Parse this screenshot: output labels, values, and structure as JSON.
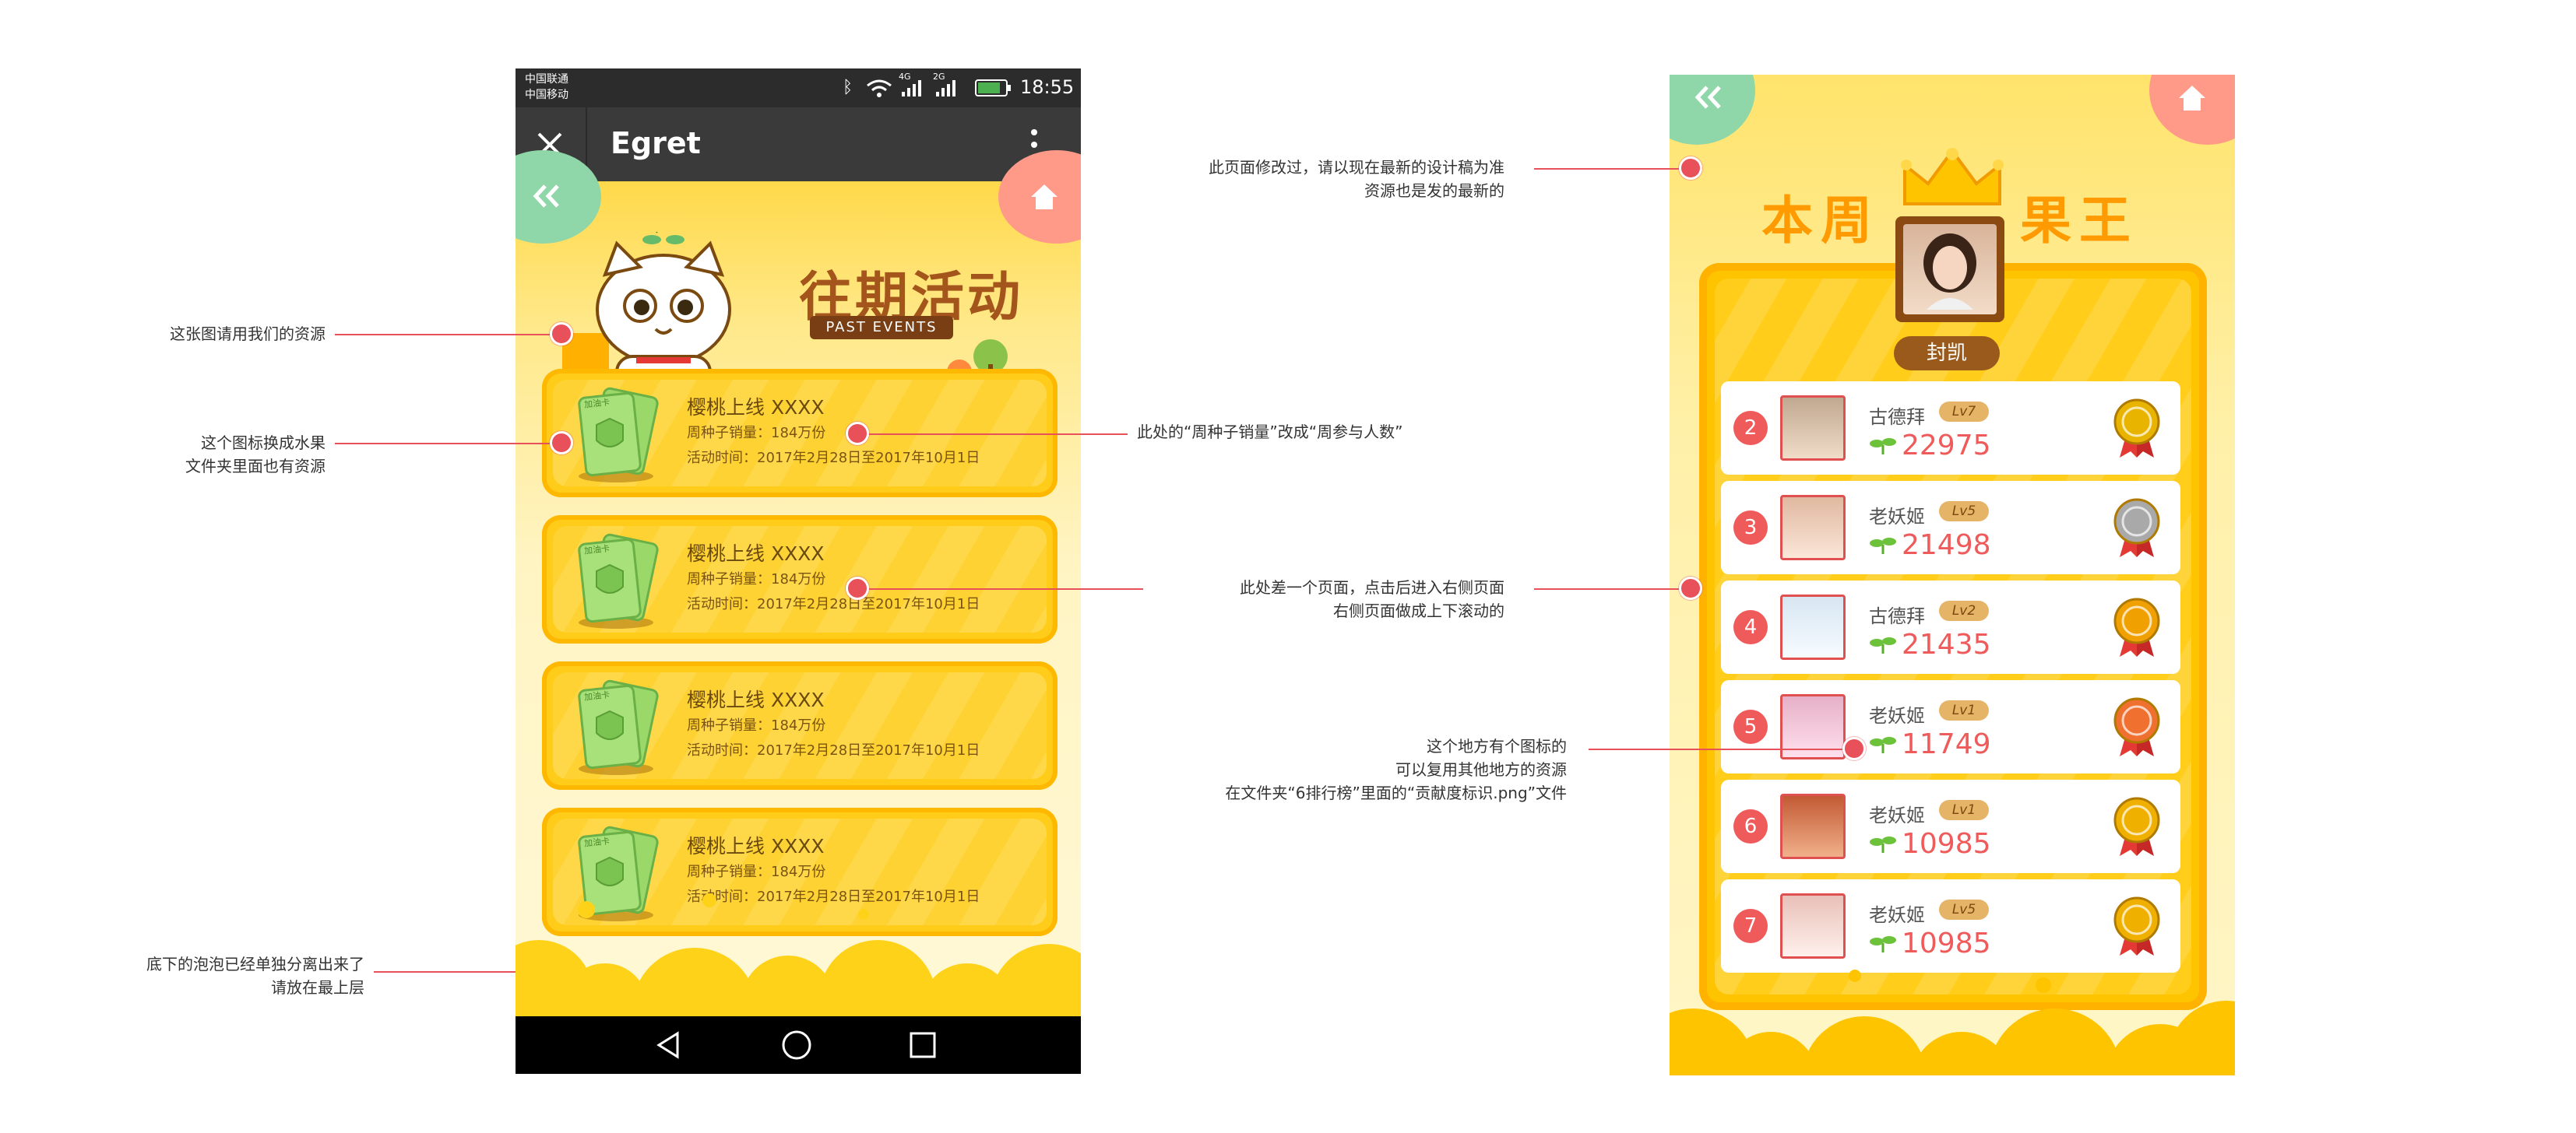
{
  "phone1": {
    "status": {
      "carrier1": "中国联通",
      "carrier2": "中国移动",
      "net1": "4G",
      "net2": "2G",
      "time": "18:55"
    },
    "title": "Egret",
    "banner_title": "往期活动",
    "banner_sub": "PAST EVENTS",
    "cards": [
      {
        "title": "樱桃上线 XXXX",
        "sales": "周种子销量：184万份",
        "time": "活动时间：2017年2月28日至2017年10月1日"
      },
      {
        "title": "樱桃上线 XXXX",
        "sales": "周种子销量：184万份",
        "time": "活动时间：2017年2月28日至2017年10月1日"
      },
      {
        "title": "樱桃上线 XXXX",
        "sales": "周种子销量：184万份",
        "time": "活动时间：2017年2月28日至2017年10月1日"
      },
      {
        "title": "樱桃上线 XXXX",
        "sales": "周种子销量：184万份",
        "time": "活动时间：2017年2月28日至2017年10月1日"
      }
    ],
    "card_label": "加油卡"
  },
  "phone2": {
    "title_left": "本周",
    "title_right": "果王",
    "king": "封凯",
    "rows": [
      {
        "rank": "2",
        "name": "古德拜",
        "lv": "Lv7",
        "score": "22975",
        "medal": "#e8b400"
      },
      {
        "rank": "3",
        "name": "老妖姬",
        "lv": "Lv5",
        "score": "21498",
        "medal": "#a9a9a9"
      },
      {
        "rank": "4",
        "name": "古德拜",
        "lv": "Lv2",
        "score": "21435",
        "medal": "#f0a000"
      },
      {
        "rank": "5",
        "name": "老妖姬",
        "lv": "Lv1",
        "score": "11749",
        "medal": "#f07030"
      },
      {
        "rank": "6",
        "name": "老妖姬",
        "lv": "Lv1",
        "score": "10985",
        "medal": "#f0b000"
      },
      {
        "rank": "7",
        "name": "老妖姬",
        "lv": "Lv5",
        "score": "10985",
        "medal": "#f0b000"
      }
    ]
  },
  "notes": {
    "n1": "这张图请用我们的资源",
    "n2": "这个图标换成水果\n文件夹里面也有资源",
    "n3": "底下的泡泡已经单独分离出来了\n请放在最上层",
    "n4": "此处的“周种子销量”改成“周参与人数”",
    "n5": "此页面修改过，请以现在最新的设计稿为准\n资源也是发的最新的",
    "n6": "此处差一个页面，点击后进入右侧页面\n右侧页面做成上下滚动的",
    "n7": "这个地方有个图标的\n可以复用其他地方的资源\n在文件夹“6排行榜”里面的“贡献度标识.png”文件"
  }
}
